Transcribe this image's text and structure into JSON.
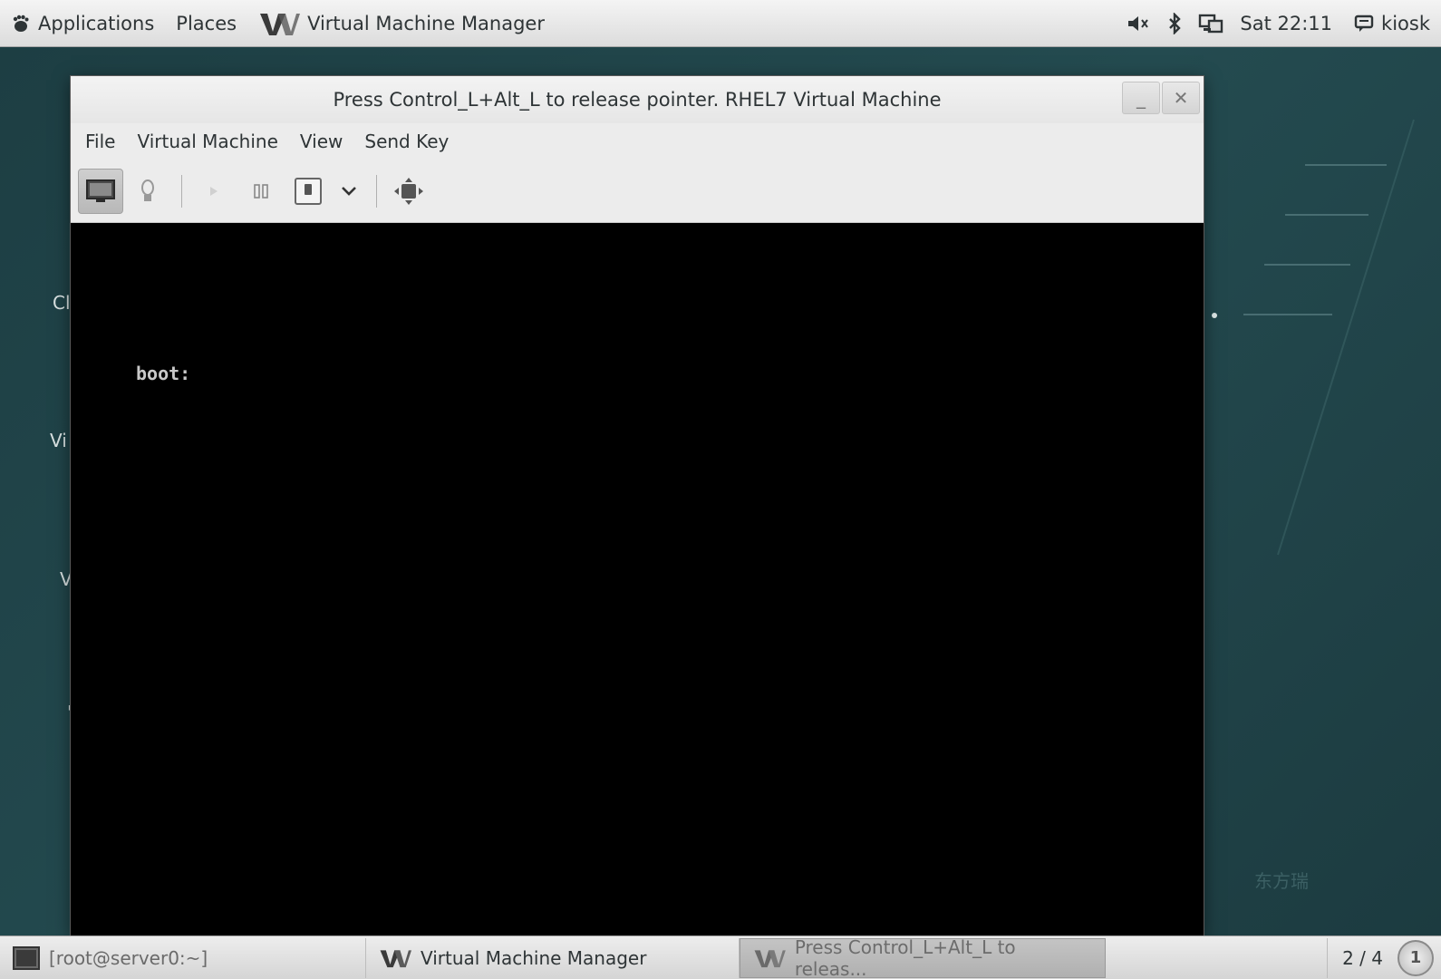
{
  "top_panel": {
    "applications": "Applications",
    "places": "Places",
    "active_app": "Virtual Machine Manager",
    "clock": "Sat 22:11",
    "user": "kiosk",
    "icons": [
      "volume-muted-icon",
      "bluetooth-icon",
      "network-icon",
      "user-icon"
    ]
  },
  "desktop": {
    "labels": [
      "Cl",
      "Vi",
      "V",
      "'"
    ]
  },
  "vm_window": {
    "title": "Press Control_L+Alt_L to release pointer. RHEL7 Virtual Machine",
    "menu": [
      "File",
      "Virtual Machine",
      "View",
      "Send Key"
    ],
    "toolbar_icons": [
      "console-icon",
      "details-lightbulb-icon",
      "run-icon",
      "pause-icon",
      "shutdown-icon",
      "dropdown-icon",
      "fullscreen-icon"
    ],
    "console_text": "boot:",
    "watermark": "东方瑞"
  },
  "taskbar": {
    "tasks": [
      {
        "label": "[root@server0:~]",
        "icon": "terminal-icon"
      },
      {
        "label": "Virtual Machine Manager",
        "icon": "vmm-icon"
      },
      {
        "label": "Press Control_L+Alt_L to releas...",
        "icon": "vmm-icon"
      }
    ],
    "workspace": "2 / 4",
    "notification_count": "1"
  }
}
